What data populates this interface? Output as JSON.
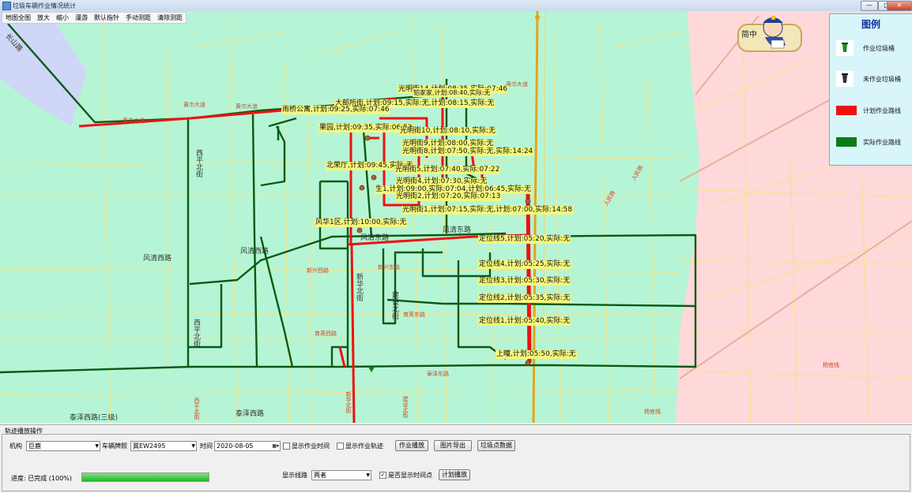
{
  "window": {
    "title": "垃圾车辆作业情况统计",
    "minimize": "—",
    "maximize": "□",
    "close": "✕"
  },
  "menu": [
    "地图全图",
    "放大",
    "缩小",
    "漫游",
    "默认指针",
    "手动测距",
    "清除测距"
  ],
  "map": {
    "poi_labels": [
      "光明街14,计划:08:35,实际:07:46",
      "铂家家,计划:08:40,实际:无",
      "大邮所街,计划:09:15,实际:无,计划:08:15,实际:无",
      "雨桥公寓,计划:09:25,实际:07:46",
      "果园,计划:09:35,实际:06:53",
      "光明街10,计划:08:10,实际:无",
      "光明街9,计划:08:00,实际:无",
      "光明街8,计划:07:50,实际:无,实际:14:24",
      "北荣厅,计划:09:45,实际:无",
      "光明街5,计划:07:40,实际:07:22",
      "光明街4,计划:07:30,实际:无",
      "生1,计划:09:00,实际:07:04,计划:06:45,实际:无",
      "光明街2,计划:07:20,实际:07:13",
      "光明街1,计划:07:15,实际:无,计划:07:00,实际:14:58",
      "风华1区,计划:10:00,实际:无",
      "定位线5,计划:05:20,实际:无",
      "定位线4,计划:05:25,实际:无",
      "定位线3,计划:05:30,实际:无",
      "定位线2,计划:05:35,实际:无",
      "定位线1,计划:05:40,实际:无",
      "上疃,计划:05:50,实际:无"
    ],
    "road_labels": [
      "长山路",
      "风清西路",
      "风清西路",
      "风清东路",
      "风清东路",
      "西平北街",
      "新华北街",
      "建设北街",
      "西平北街",
      "泰泽西路(三级)",
      "泰泽西路"
    ],
    "red_road_labels": [
      "黄巾大道",
      "黄巾大道",
      "黄巾大道",
      "黄巾大道",
      "新兴西路",
      "新兴东路",
      "育英东路",
      "育英西路",
      "西平北街",
      "新华北街",
      "建设北街",
      "人民路",
      "人民路",
      "杨官线",
      "杨官线",
      "泰泽东路"
    ]
  },
  "legend": {
    "title": "图例",
    "items": [
      {
        "label": "作业垃圾桶",
        "kind": "bin-active"
      },
      {
        "label": "未作业垃圾桶",
        "kind": "bin-idle"
      },
      {
        "label": "计划作业路线",
        "kind": "line",
        "color": "#ee1111"
      },
      {
        "label": "实际作业路线",
        "kind": "line",
        "color": "#0a7a1a"
      }
    ]
  },
  "mascot": {
    "text": "简中"
  },
  "panel": {
    "title": "轨迹播放操作",
    "org_label": "机构",
    "org_value": "巨鹿",
    "plate_label": "车辆牌照",
    "plate_value": "冀EW2495",
    "time_label": "时间",
    "date_value": "2020-08-05",
    "show_work_time": "显示作业时间",
    "show_work_track": "显示作业轨迹",
    "btn_play": "作业播放",
    "btn_export": "图片导出",
    "btn_bins": "垃圾点数据",
    "progress_label": "进度: 已完成 (100%)",
    "progress_value": 1.0,
    "route_label": "显示线路",
    "route_value": "两者",
    "show_time_points": "是否显示时间点",
    "show_time_points_checked": true,
    "btn_plan": "计划播放"
  },
  "colors": {
    "map_bg": "#b5f5d6",
    "plan": "#ee1111",
    "actual": "#0a5a14",
    "yellow_road": "#f2e58c"
  }
}
